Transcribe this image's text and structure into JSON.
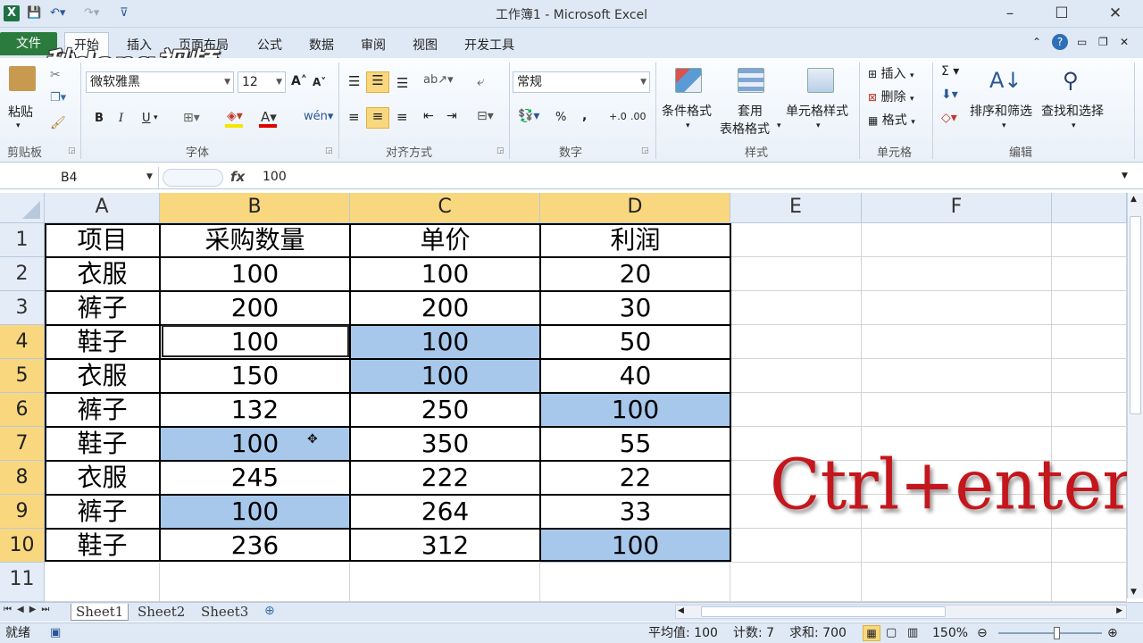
{
  "window": {
    "title": "工作簿1 - Microsoft Excel"
  },
  "ribbon_tabs": {
    "file": "文件",
    "home": "开始",
    "insert": "插入",
    "layout": "页面布局",
    "formulas": "公式",
    "data": "数据",
    "review": "审阅",
    "view": "视图",
    "developer": "开发工具"
  },
  "watermark": "秒dong视频",
  "clipboard": {
    "paste": "粘贴",
    "label": "剪贴板"
  },
  "font": {
    "name": "微软雅黑",
    "size": "12",
    "label": "字体",
    "bold": "B",
    "italic": "I",
    "underline": "U"
  },
  "alignment": {
    "label": "对齐方式"
  },
  "number": {
    "format": "常规",
    "label": "数字",
    "percent": "%",
    "comma": ","
  },
  "styles": {
    "conditional": "条件格式",
    "table_line1": "套用",
    "table_line2": "表格格式",
    "cell_styles": "单元格样式",
    "label": "样式"
  },
  "cells": {
    "insert": "插入",
    "delete": "删除",
    "format": "格式",
    "label": "单元格"
  },
  "editing": {
    "sort": "排序和筛选",
    "find": "查找和选择",
    "label": "编辑"
  },
  "formula_bar": {
    "name_box": "B4",
    "fx": "fx",
    "value": "100"
  },
  "columns": [
    "A",
    "B",
    "C",
    "D",
    "E",
    "F"
  ],
  "rows": [
    "1",
    "2",
    "3",
    "4",
    "5",
    "6",
    "7",
    "8",
    "9",
    "10",
    "11"
  ],
  "table": {
    "header": [
      "项目",
      "采购数量",
      "单价",
      "利润"
    ],
    "data": [
      [
        "衣服",
        "100",
        "100",
        "20"
      ],
      [
        "裤子",
        "200",
        "200",
        "30"
      ],
      [
        "鞋子",
        "100",
        "100",
        "50"
      ],
      [
        "衣服",
        "150",
        "100",
        "40"
      ],
      [
        "裤子",
        "132",
        "250",
        "100"
      ],
      [
        "鞋子",
        "100",
        "350",
        "55"
      ],
      [
        "衣服",
        "245",
        "222",
        "22"
      ],
      [
        "裤子",
        "100",
        "264",
        "33"
      ],
      [
        "鞋子",
        "236",
        "312",
        "100"
      ]
    ]
  },
  "sheets": [
    "Sheet1",
    "Sheet2",
    "Sheet3"
  ],
  "status": {
    "ready": "就绪",
    "average": "平均值: 100",
    "count": "计数: 7",
    "sum": "求和: 700",
    "zoom": "150%"
  },
  "annotation": "Ctrl+enter",
  "colors": {
    "selection": "#a7c8eb",
    "header_selected": "#f9d77e",
    "file_tab": "#2b7b3d",
    "annotation": "#c4161c"
  }
}
